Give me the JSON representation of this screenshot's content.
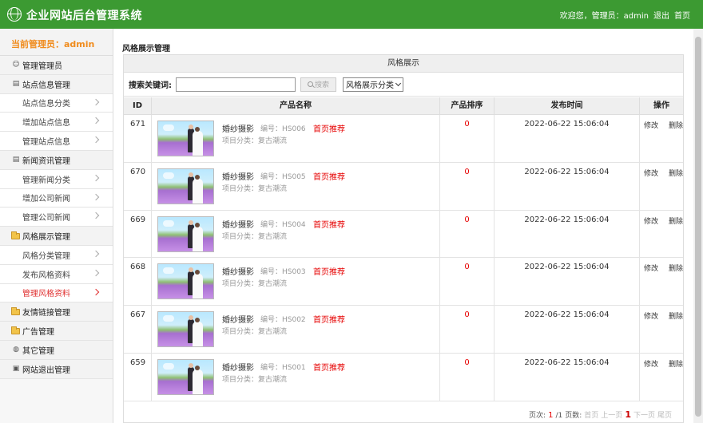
{
  "header": {
    "title": "企业网站后台管理系统",
    "welcome": "欢迎您，管理员：admin",
    "logout": "退出",
    "home": "首页"
  },
  "sidebar": {
    "user_label": "当前管理员：admin",
    "items": [
      {
        "type": "group",
        "label": "管理管理员",
        "icon": "user-icon"
      },
      {
        "type": "group",
        "label": "站点信息管理",
        "icon": "document-icon"
      },
      {
        "type": "sub",
        "label": "站点信息分类"
      },
      {
        "type": "sub",
        "label": "增加站点信息"
      },
      {
        "type": "sub",
        "label": "管理站点信息"
      },
      {
        "type": "group",
        "label": "新闻资讯管理",
        "icon": "document-icon"
      },
      {
        "type": "sub",
        "label": "管理新闻分类"
      },
      {
        "type": "sub",
        "label": "增加公司新闻"
      },
      {
        "type": "sub",
        "label": "管理公司新闻"
      },
      {
        "type": "group",
        "label": "风格展示管理",
        "icon": "folder-icon"
      },
      {
        "type": "sub",
        "label": "风格分类管理"
      },
      {
        "type": "sub",
        "label": "发布风格资料"
      },
      {
        "type": "sub",
        "label": "管理风格资料",
        "active": true
      },
      {
        "type": "group",
        "label": "友情链接管理",
        "icon": "folder-icon"
      },
      {
        "type": "group",
        "label": "广告管理",
        "icon": "folder-icon"
      },
      {
        "type": "group",
        "label": "其它管理",
        "icon": "globe-icon"
      },
      {
        "type": "group",
        "label": "网站退出管理",
        "icon": "exit-icon"
      }
    ]
  },
  "main": {
    "title": "风格展示管理",
    "panel_title": "风格展示",
    "search_label": "搜索关键词:",
    "search_value": "",
    "search_button": "搜索",
    "category_select": "风格展示分类",
    "columns": [
      "ID",
      "产品名称",
      "产品排序",
      "发布时间",
      "操作"
    ],
    "rows": [
      {
        "id": "671",
        "name": "婚纱摄影",
        "code": "编号：HS006",
        "flag": "首页推荐",
        "category": "项目分类：复古潮流",
        "sort": "0",
        "time": "2022-06-22 15:06:04"
      },
      {
        "id": "670",
        "name": "婚纱摄影",
        "code": "编号：HS005",
        "flag": "首页推荐",
        "category": "项目分类：复古潮流",
        "sort": "0",
        "time": "2022-06-22 15:06:04"
      },
      {
        "id": "669",
        "name": "婚纱摄影",
        "code": "编号：HS004",
        "flag": "首页推荐",
        "category": "项目分类：复古潮流",
        "sort": "0",
        "time": "2022-06-22 15:06:04"
      },
      {
        "id": "668",
        "name": "婚纱摄影",
        "code": "编号：HS003",
        "flag": "首页推荐",
        "category": "项目分类：复古潮流",
        "sort": "0",
        "time": "2022-06-22 15:06:04"
      },
      {
        "id": "667",
        "name": "婚纱摄影",
        "code": "编号：HS002",
        "flag": "首页推荐",
        "category": "项目分类：复古潮流",
        "sort": "0",
        "time": "2022-06-22 15:06:04"
      },
      {
        "id": "659",
        "name": "婚纱摄影",
        "code": "编号：HS001",
        "flag": "首页推荐",
        "category": "项目分类：复古潮流",
        "sort": "0",
        "time": "2022-06-22 15:06:04"
      }
    ],
    "op_edit": "修改",
    "op_delete": "删除",
    "pager": {
      "page_label": "页次:",
      "current_page": "1",
      "total_pages": "/1",
      "pages_label": "页数:",
      "first": "首页",
      "prev": "上一页",
      "page_num": "1",
      "next": "下一页",
      "last": "尾页"
    }
  },
  "colors": {
    "header_bg": "#3c9a32",
    "admin_orange": "#f08c1e",
    "accent_red": "#e60000"
  }
}
